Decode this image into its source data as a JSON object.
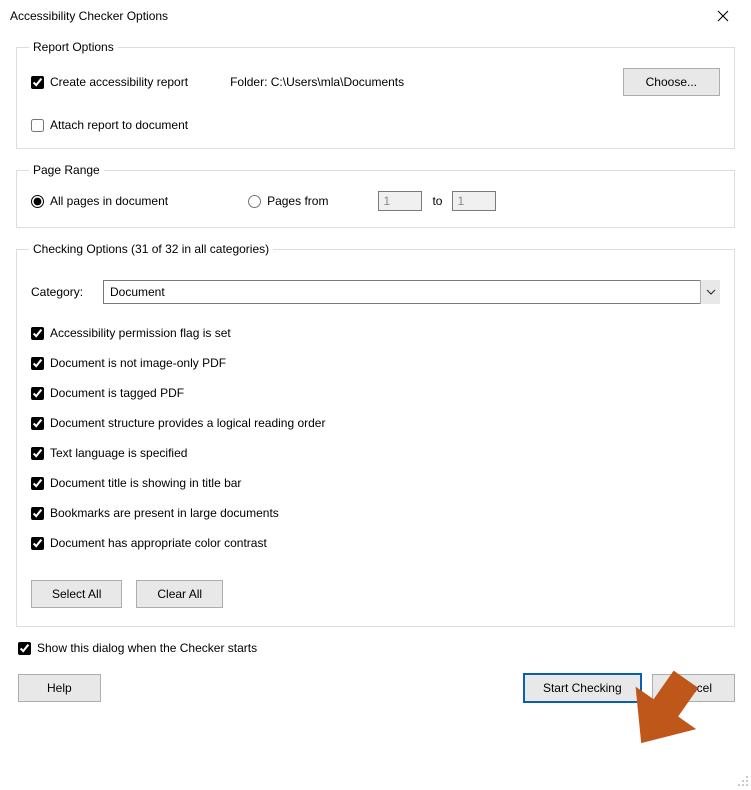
{
  "window": {
    "title": "Accessibility Checker Options"
  },
  "reportOptions": {
    "legend": "Report Options",
    "createReportLabel": "Create accessibility report",
    "createReportChecked": true,
    "folderPrefix": "Folder:",
    "folderPath": "C:\\Users\\mla\\Documents",
    "chooseLabel": "Choose...",
    "attachLabel": "Attach report to document",
    "attachChecked": false
  },
  "pageRange": {
    "legend": "Page Range",
    "allPagesLabel": "All pages in document",
    "pagesFromLabel": "Pages from",
    "fromValue": "1",
    "toLabel": "to",
    "toValue": "1",
    "selected": "all"
  },
  "checkingOptions": {
    "legend": "Checking Options (31 of 32 in all categories)",
    "categoryLabel": "Category:",
    "categoryValue": "Document",
    "items": [
      {
        "label": "Accessibility permission flag is set",
        "checked": true
      },
      {
        "label": "Document is not image-only PDF",
        "checked": true
      },
      {
        "label": "Document is tagged PDF",
        "checked": true
      },
      {
        "label": "Document structure provides a logical reading order",
        "checked": true
      },
      {
        "label": "Text language is specified",
        "checked": true
      },
      {
        "label": "Document title is showing in title bar",
        "checked": true
      },
      {
        "label": "Bookmarks are present in large documents",
        "checked": true
      },
      {
        "label": "Document has appropriate color contrast",
        "checked": true
      }
    ],
    "selectAllLabel": "Select All",
    "clearAllLabel": "Clear All"
  },
  "bottom": {
    "showDialogLabel": "Show this dialog when the Checker starts",
    "showDialogChecked": true
  },
  "footer": {
    "helpLabel": "Help",
    "startLabel": "Start Checking",
    "cancelLabel": "Cancel"
  },
  "annotation": {
    "arrowColor": "#c0571a"
  }
}
